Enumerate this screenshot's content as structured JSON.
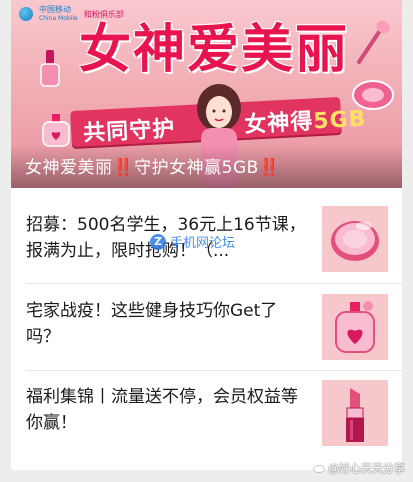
{
  "banner": {
    "logo_text": "中国移动",
    "logo_sub": "China Mobile",
    "club_text": "和粉俱乐部",
    "headline": "女神爱美丽",
    "ribbon_left": "共同守护",
    "ribbon_right": "女神得",
    "ribbon_highlight": "5GB",
    "caption_main": "女神爱美丽",
    "caption_mark_1": "‼️",
    "caption_mid": "守护女神赢5GB",
    "caption_mark_2": "‼️"
  },
  "articles": [
    {
      "title": "招募：500名学生，36元上16节课，报满为止，限时抢购！（...",
      "thumb_icon": "compact-mirror-icon"
    },
    {
      "title": "宅家战疫！这些健身技巧你Get了吗？",
      "thumb_icon": "perfume-bottle-icon"
    },
    {
      "title": "福利集锦丨流量送不停，会员权益等你赢！",
      "thumb_icon": "lipstick-icon"
    }
  ],
  "watermarks": {
    "forum": "手机网论坛",
    "forum_badge": "Z",
    "weibo": "@好心天天分享"
  },
  "colors": {
    "banner_pink": "#f3b1b8",
    "title_red": "#e8144f",
    "ribbon": "#e23461",
    "thumb_bg": "#f6c8cc"
  }
}
